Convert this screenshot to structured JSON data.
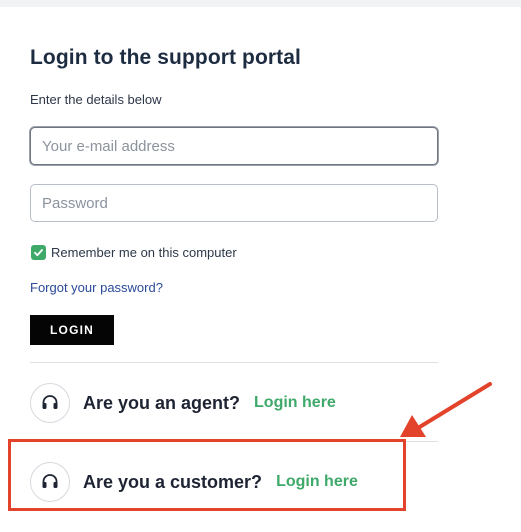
{
  "login": {
    "title": "Login to the support portal",
    "subtitle": "Enter the details below",
    "email_placeholder": "Your e-mail address",
    "password_placeholder": "Password",
    "remember_label": "Remember me on this computer",
    "remember_checked": true,
    "forgot_label": "Forgot your password?",
    "login_button": "LOGIN"
  },
  "alternatives": [
    {
      "question": "Are you an agent?",
      "link": "Login here",
      "icon": "headset-icon"
    },
    {
      "question": "Are you a customer?",
      "link": "Login here",
      "icon": "headset-icon"
    }
  ],
  "annotation": {
    "highlighted": "Are you a customer?",
    "color": "#e3432b"
  },
  "colors": {
    "accent_green": "#3fa96a",
    "link_blue": "#2a4a9a",
    "button_black": "#050505"
  }
}
